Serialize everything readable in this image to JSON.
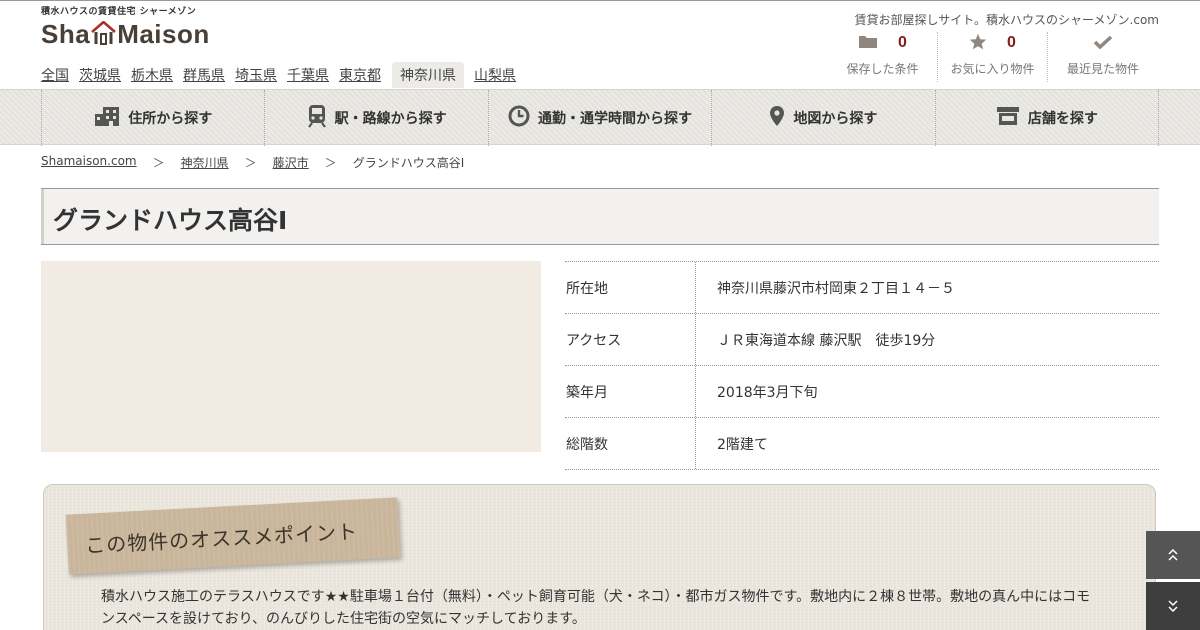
{
  "header": {
    "logo_sub": "積水ハウスの賃貸住宅 シャーメゾン",
    "logo_text_left": "Sha",
    "logo_text_right": "Maison",
    "tagline": "賃貸お部屋探しサイト。積水ハウスのシャーメゾン.com",
    "prefectures": [
      "全国",
      "茨城県",
      "栃木県",
      "群馬県",
      "埼玉県",
      "千葉県",
      "東京都",
      "神奈川県",
      "山梨県"
    ],
    "active_prefecture": "神奈川県",
    "counters": [
      {
        "icon": "folder-icon",
        "count": "0",
        "label": "保存した条件"
      },
      {
        "icon": "star-icon",
        "count": "0",
        "label": "お気に入り物件"
      },
      {
        "icon": "checkmark-icon",
        "count": "",
        "label": "最近見た物件"
      }
    ]
  },
  "nav": [
    {
      "icon": "building-icon",
      "label": "住所から探す"
    },
    {
      "icon": "train-icon",
      "label": "駅・路線から探す"
    },
    {
      "icon": "clock-icon",
      "label": "通勤・通学時間から探す"
    },
    {
      "icon": "map-pin-icon",
      "label": "地図から探す"
    },
    {
      "icon": "shop-icon",
      "label": "店舗を探す"
    }
  ],
  "breadcrumb": [
    "Shamaison.com",
    "神奈川県",
    "藤沢市",
    "グランドハウス高谷Ⅰ"
  ],
  "breadcrumb_sep": "＞",
  "property": {
    "title": "グランドハウス高谷Ⅰ",
    "info": [
      {
        "label": "所在地",
        "value": "神奈川県藤沢市村岡東２丁目１４－５"
      },
      {
        "label": "アクセス",
        "value": "ＪＲ東海道本線 藤沢駅　徒歩19分"
      },
      {
        "label": "築年月",
        "value": "2018年3月下旬"
      },
      {
        "label": "総階数",
        "value": "2階建て"
      }
    ]
  },
  "recommend": {
    "heading": "この物件のオススメポイント",
    "body": "積水ハウス施工のテラスハウスです★★駐車場１台付（無料）・ペット飼育可能（犬・ネコ）・都市ガス物件です。敷地内に２棟８世帯。敷地の真ん中にはコモンスペースを設けており、のんびりした住宅街の空気にマッチしております。"
  },
  "colors": {
    "accent_count": "#8b1a1a",
    "nav_bg": "#e8e6e1",
    "photo_placeholder": "#f2ebe4",
    "recommend_tag": "#c8b59a"
  }
}
